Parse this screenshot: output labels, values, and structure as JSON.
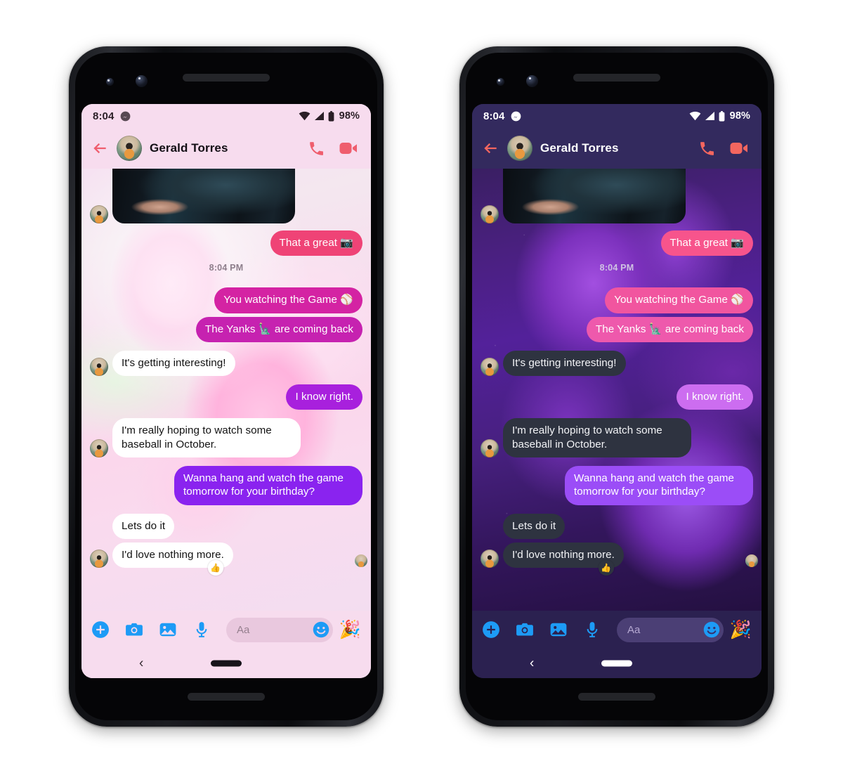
{
  "phones": [
    {
      "id": "light",
      "theme_label": "light",
      "colors": {
        "header_bg": "#f7dcee",
        "accent": "#ef5e6e",
        "icon_blue": "#1d9bf6",
        "bubble_start": "#ef4376",
        "bubble_end": "#8a23ef"
      }
    },
    {
      "id": "dark",
      "theme_label": "dark",
      "colors": {
        "header_bg": "#332a5e",
        "accent": "#f4665f",
        "icon_blue": "#1d9bf6",
        "bubble_start": "#f7548c",
        "bubble_end": "#9b4df7"
      }
    }
  ],
  "status_bar": {
    "time": "8:04",
    "notification_icon": "messenger-icon",
    "wifi_icon": "wifi-icon",
    "signal_icon": "cell-signal-icon",
    "battery_icon": "battery-icon",
    "battery_percent": "98%"
  },
  "header": {
    "back_icon": "back-arrow-icon",
    "avatar": "contact-avatar",
    "contact_name": "Gerald Torres",
    "call_icon": "phone-call-icon",
    "video_icon": "video-call-icon"
  },
  "thread": {
    "photo_attachment_alt": "photo-attachment",
    "timestamp": "8:04 PM",
    "messages": [
      {
        "id": "m1",
        "dir": "out",
        "text": "That a great ",
        "emoji": "📷",
        "grad": 0
      },
      {
        "id": "m2",
        "dir": "out",
        "text": "You watching the Game ",
        "emoji": "⚾",
        "grad": 1
      },
      {
        "id": "m3",
        "dir": "out",
        "text": "The Yanks ",
        "emoji": "🗽",
        "text_after": " are coming back",
        "grad": 2
      },
      {
        "id": "m4",
        "dir": "in",
        "text": "It's getting interesting!"
      },
      {
        "id": "m5",
        "dir": "out",
        "text": "I know right.",
        "grad": 3
      },
      {
        "id": "m6",
        "dir": "in",
        "text": "I'm really hoping to watch some baseball in October."
      },
      {
        "id": "m7",
        "dir": "out",
        "text": "Wanna hang and watch the game tomorrow for your birthday?",
        "grad": 4
      },
      {
        "id": "m8",
        "dir": "in",
        "text": "Lets do it"
      },
      {
        "id": "m9",
        "dir": "in",
        "text": "I'd love nothing more.",
        "reaction": "👍"
      }
    ]
  },
  "composer": {
    "add_icon": "plus-circle-icon",
    "camera_icon": "camera-icon",
    "gallery_icon": "gallery-image-icon",
    "mic_icon": "microphone-icon",
    "input_placeholder": "Aa",
    "emoji_icon": "smiley-face-icon",
    "sticker": "🎉"
  },
  "nav_bar": {
    "back_glyph": "‹",
    "home_pill": "home-pill"
  }
}
